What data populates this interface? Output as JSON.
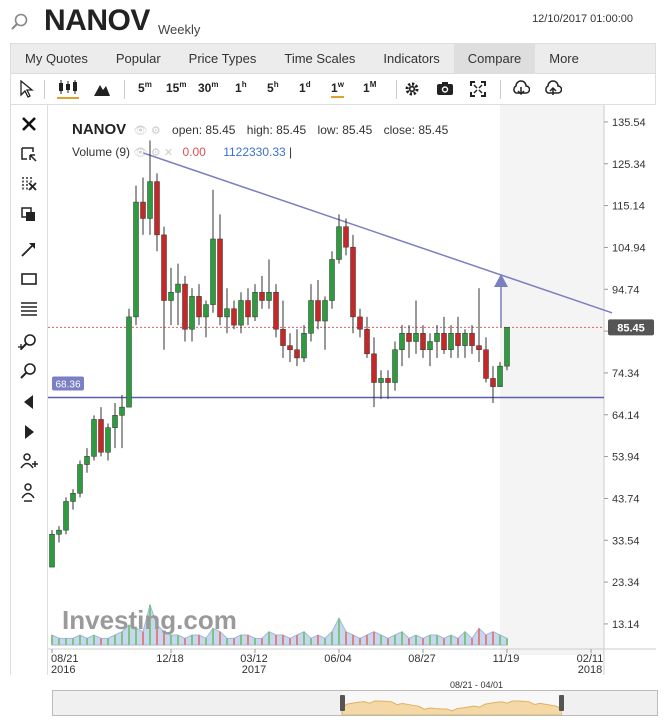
{
  "header": {
    "symbol": "NANOV",
    "timeframe": "Weekly",
    "datetime": "12/10/2017 01:00:00"
  },
  "menu": [
    "My Quotes",
    "Popular",
    "Price Types",
    "Time Scales",
    "Indicators",
    "Compare",
    "More"
  ],
  "menu_active": "Compare",
  "toolbar": {
    "intervals": [
      {
        "base": "5",
        "unit": "m"
      },
      {
        "base": "15",
        "unit": "m"
      },
      {
        "base": "30",
        "unit": "m"
      },
      {
        "base": "1",
        "unit": "h"
      },
      {
        "base": "5",
        "unit": "h"
      },
      {
        "base": "1",
        "unit": "d"
      },
      {
        "base": "1",
        "unit": "w"
      },
      {
        "base": "1",
        "unit": "M"
      }
    ],
    "selected_interval": "1w"
  },
  "legend": {
    "symbol": "NANOV",
    "open_label": "open:",
    "open": "85.45",
    "high_label": "high:",
    "high": "85.45",
    "low_label": "low:",
    "low": "85.45",
    "close_label": "close:",
    "close": "85.45",
    "volume_label": "Volume",
    "volume_param": "(9)",
    "volume_change": "0.00",
    "volume_value": "1122330.33"
  },
  "colors": {
    "up": "#2e9b3e",
    "down": "#c62828",
    "trendline": "#7b7fbf",
    "horizontal_line": "#5a5fb0",
    "price_line": "#e06060",
    "price_tag_bg": "#555555",
    "hline_tag_bg": "#7b7fc4",
    "volume_area": "#c7d8ee"
  },
  "watermark": "Investing.com",
  "navigator_range": "08/21 - 04/01",
  "chart_data": {
    "type": "candlestick",
    "yticks": [
      13.14,
      23.34,
      33.54,
      43.74,
      53.94,
      64.14,
      74.34,
      84.54,
      94.74,
      104.94,
      115.14,
      125.34,
      135.54
    ],
    "ytick_labels": [
      "13.14",
      "23.34",
      "33.54",
      "43.74",
      "53.94",
      "64.14",
      "74.34",
      "",
      "94.74",
      "104.94",
      "115.14",
      "125.34",
      "135.54"
    ],
    "ylim": [
      8.0,
      136.5
    ],
    "xtick_labels": [
      {
        "label": "08/21",
        "sub": "2016",
        "i": 0
      },
      {
        "label": "12/18",
        "sub": "",
        "i": 17
      },
      {
        "label": "03/12",
        "sub": "2017",
        "i": 29
      },
      {
        "label": "06/04",
        "sub": "",
        "i": 41
      },
      {
        "label": "08/27",
        "sub": "",
        "i": 53
      },
      {
        "label": "11/19",
        "sub": "",
        "i": 65
      },
      {
        "label": "02/11",
        "sub": "2018",
        "i": 77
      }
    ],
    "last_price": "85.45",
    "hline_value": "68.36",
    "trendline": {
      "from": {
        "i": 13,
        "y": 128.0
      },
      "to": {
        "i": 80,
        "y": 89.0
      }
    },
    "arrow": {
      "i": 64,
      "from": 85.45,
      "to": 97.5
    },
    "candles": [
      {
        "o": 27,
        "h": 36,
        "l": 27,
        "c": 35
      },
      {
        "o": 35,
        "h": 37,
        "l": 33,
        "c": 36
      },
      {
        "o": 36,
        "h": 44,
        "l": 35,
        "c": 43
      },
      {
        "o": 43,
        "h": 46,
        "l": 41,
        "c": 45
      },
      {
        "o": 45,
        "h": 53,
        "l": 44,
        "c": 52
      },
      {
        "o": 52,
        "h": 56,
        "l": 50,
        "c": 54
      },
      {
        "o": 54,
        "h": 64,
        "l": 53,
        "c": 63
      },
      {
        "o": 63,
        "h": 66,
        "l": 54,
        "c": 55
      },
      {
        "o": 55,
        "h": 62,
        "l": 53,
        "c": 61
      },
      {
        "o": 61,
        "h": 67,
        "l": 56,
        "c": 64
      },
      {
        "o": 64,
        "h": 69,
        "l": 56,
        "c": 66
      },
      {
        "o": 66,
        "h": 90,
        "l": 66,
        "c": 88
      },
      {
        "o": 88,
        "h": 120,
        "l": 86,
        "c": 116
      },
      {
        "o": 116,
        "h": 122,
        "l": 108,
        "c": 112
      },
      {
        "o": 112,
        "h": 131,
        "l": 108,
        "c": 121
      },
      {
        "o": 121,
        "h": 123,
        "l": 104,
        "c": 108
      },
      {
        "o": 108,
        "h": 110,
        "l": 80,
        "c": 92
      },
      {
        "o": 92,
        "h": 100,
        "l": 86,
        "c": 94
      },
      {
        "o": 94,
        "h": 101,
        "l": 86,
        "c": 96
      },
      {
        "o": 96,
        "h": 98,
        "l": 82,
        "c": 85
      },
      {
        "o": 85,
        "h": 95,
        "l": 82,
        "c": 93
      },
      {
        "o": 93,
        "h": 96,
        "l": 86,
        "c": 88
      },
      {
        "o": 88,
        "h": 92,
        "l": 83,
        "c": 91
      },
      {
        "o": 91,
        "h": 119,
        "l": 89,
        "c": 107
      },
      {
        "o": 107,
        "h": 113,
        "l": 86,
        "c": 88
      },
      {
        "o": 88,
        "h": 95,
        "l": 84,
        "c": 90
      },
      {
        "o": 90,
        "h": 92,
        "l": 85,
        "c": 86
      },
      {
        "o": 86,
        "h": 94,
        "l": 84,
        "c": 92
      },
      {
        "o": 92,
        "h": 95,
        "l": 86,
        "c": 88
      },
      {
        "o": 88,
        "h": 96,
        "l": 87,
        "c": 94
      },
      {
        "o": 94,
        "h": 98,
        "l": 90,
        "c": 92
      },
      {
        "o": 92,
        "h": 102,
        "l": 90,
        "c": 94
      },
      {
        "o": 94,
        "h": 96,
        "l": 83,
        "c": 85
      },
      {
        "o": 85,
        "h": 92,
        "l": 78,
        "c": 81
      },
      {
        "o": 81,
        "h": 84,
        "l": 77,
        "c": 80
      },
      {
        "o": 80,
        "h": 85,
        "l": 76,
        "c": 78
      },
      {
        "o": 78,
        "h": 86,
        "l": 77,
        "c": 84
      },
      {
        "o": 84,
        "h": 96,
        "l": 82,
        "c": 92
      },
      {
        "o": 92,
        "h": 97,
        "l": 85,
        "c": 87
      },
      {
        "o": 87,
        "h": 93,
        "l": 80,
        "c": 92
      },
      {
        "o": 92,
        "h": 104,
        "l": 90,
        "c": 102
      },
      {
        "o": 102,
        "h": 113,
        "l": 101,
        "c": 110
      },
      {
        "o": 110,
        "h": 112,
        "l": 103,
        "c": 105
      },
      {
        "o": 105,
        "h": 108,
        "l": 84,
        "c": 88
      },
      {
        "o": 88,
        "h": 90,
        "l": 83,
        "c": 85
      },
      {
        "o": 85,
        "h": 88,
        "l": 78,
        "c": 79
      },
      {
        "o": 79,
        "h": 83,
        "l": 66,
        "c": 72
      },
      {
        "o": 72,
        "h": 75,
        "l": 68,
        "c": 73
      },
      {
        "o": 73,
        "h": 75,
        "l": 68,
        "c": 72
      },
      {
        "o": 72,
        "h": 82,
        "l": 70,
        "c": 80
      },
      {
        "o": 80,
        "h": 86,
        "l": 76,
        "c": 84
      },
      {
        "o": 84,
        "h": 86,
        "l": 78,
        "c": 82
      },
      {
        "o": 82,
        "h": 92,
        "l": 79,
        "c": 84
      },
      {
        "o": 84,
        "h": 86,
        "l": 78,
        "c": 80
      },
      {
        "o": 80,
        "h": 84,
        "l": 76,
        "c": 82
      },
      {
        "o": 82,
        "h": 86,
        "l": 78,
        "c": 84
      },
      {
        "o": 84,
        "h": 88,
        "l": 79,
        "c": 80
      },
      {
        "o": 80,
        "h": 86,
        "l": 78,
        "c": 84
      },
      {
        "o": 84,
        "h": 88,
        "l": 78,
        "c": 81
      },
      {
        "o": 81,
        "h": 85,
        "l": 78,
        "c": 84
      },
      {
        "o": 84,
        "h": 86,
        "l": 79,
        "c": 81
      },
      {
        "o": 81,
        "h": 95,
        "l": 77,
        "c": 80
      },
      {
        "o": 80,
        "h": 83,
        "l": 72,
        "c": 73
      },
      {
        "o": 73,
        "h": 76,
        "l": 67,
        "c": 71
      },
      {
        "o": 71,
        "h": 77,
        "l": 71,
        "c": 76
      },
      {
        "o": 76,
        "h": 85.45,
        "l": 75,
        "c": 85.45
      }
    ],
    "volumes": [
      3,
      2,
      2,
      2,
      3,
      2,
      3,
      2,
      2,
      3,
      4,
      6,
      5,
      4,
      12,
      6,
      4,
      3,
      3,
      2,
      3,
      3,
      2,
      5,
      4,
      2,
      2,
      3,
      3,
      2,
      2,
      4,
      3,
      3,
      2,
      3,
      4,
      2,
      3,
      2,
      4,
      8,
      4,
      3,
      2,
      3,
      4,
      3,
      2,
      3,
      4,
      2,
      3,
      2,
      3,
      3,
      2,
      3,
      2,
      4,
      2,
      5,
      3,
      4,
      3,
      2
    ]
  }
}
